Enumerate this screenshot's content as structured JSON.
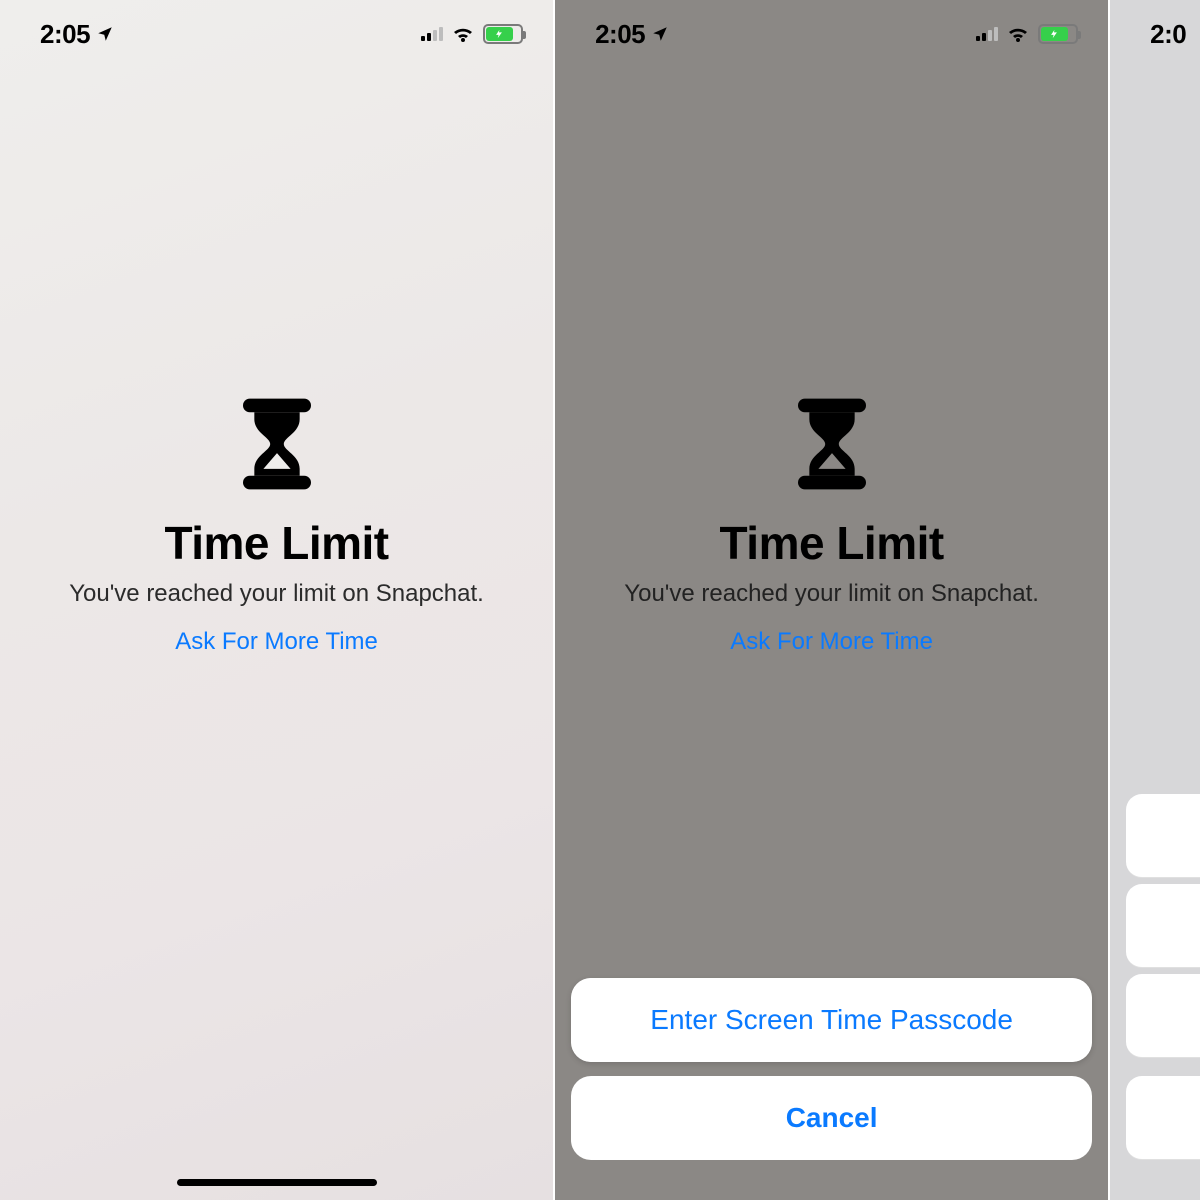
{
  "status": {
    "time": "2:05",
    "location_icon": "location-arrow-icon",
    "signal_icon": "cellular-signal-icon",
    "wifi_icon": "wifi-icon",
    "battery_icon": "battery-charging-icon"
  },
  "screens": [
    {
      "icon": "hourglass-icon",
      "title": "Time Limit",
      "subtitle": "You've reached your limit on Snapchat.",
      "link": "Ask For More Time"
    },
    {
      "icon": "hourglass-icon",
      "title": "Time Limit",
      "subtitle": "You've reached your limit on Snapchat.",
      "link": "Ask For More Time",
      "action_sheet": {
        "options": [
          "Enter Screen Time Passcode"
        ],
        "cancel": "Cancel"
      }
    },
    {
      "partial_time": "2:0"
    }
  ],
  "colors": {
    "accent": "#0a7aff",
    "battery_fill": "#36d04b"
  }
}
